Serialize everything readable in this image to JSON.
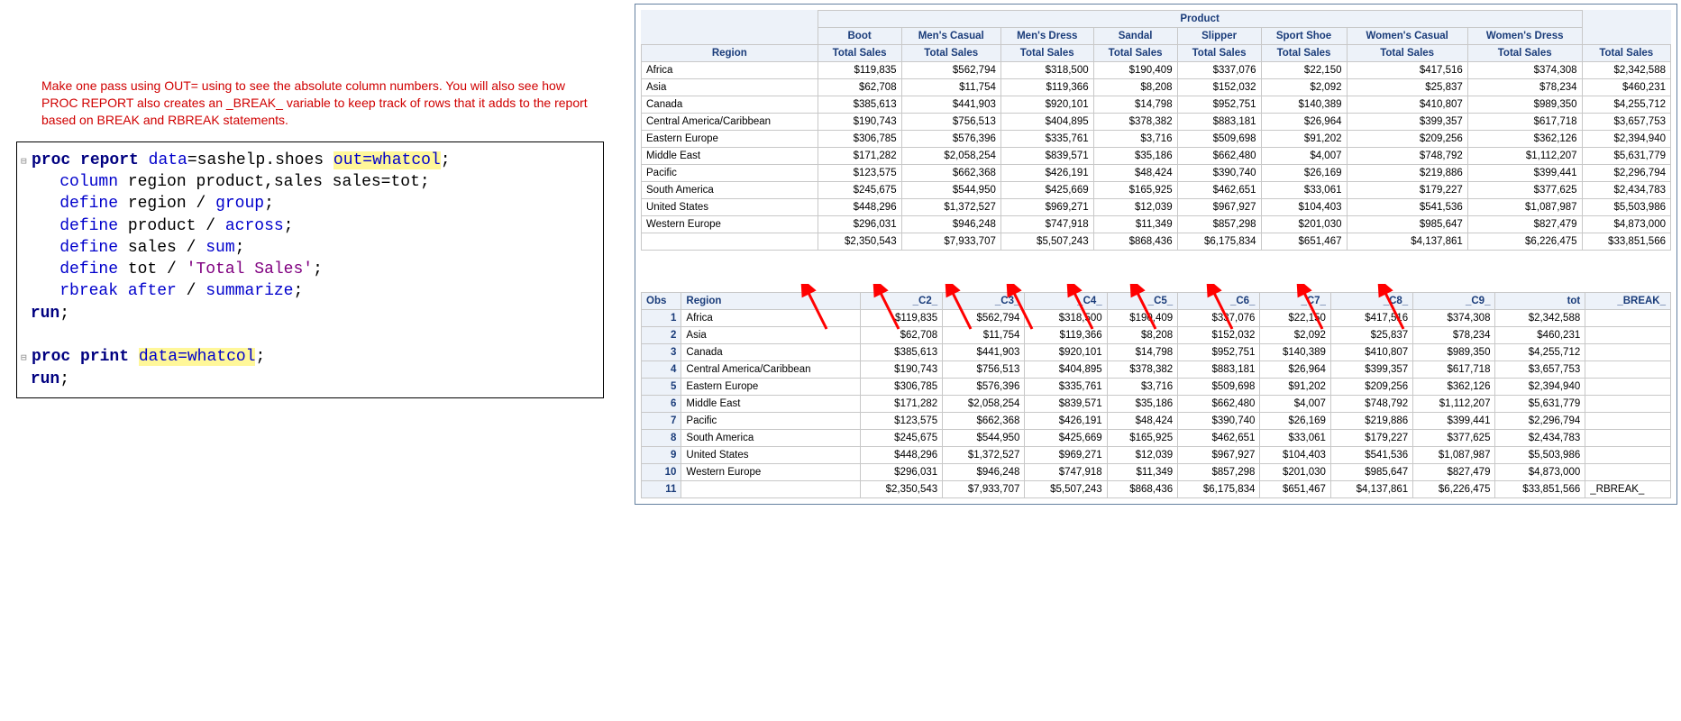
{
  "comment": "Make one pass using OUT= using to see the absolute column numbers. You will also see how PROC REPORT also creates an _BREAK_ variable to keep track of rows that it adds to the report based on BREAK and RBREAK statements.",
  "code": {
    "l1a": "proc",
    "l1b": "report",
    "l1c": "data",
    "l1d": "=sashelp.shoes ",
    "l1e": "out=whatcol",
    "l1f": ";",
    "l2a": "   column",
    "l2b": " region product,sales sales=tot;",
    "l3a": "   define",
    "l3b": " region / ",
    "l3c": "group",
    "l3d": ";",
    "l4a": "   define",
    "l4b": " product / ",
    "l4c": "across",
    "l4d": ";",
    "l5a": "   define",
    "l5b": " sales / ",
    "l5c": "sum",
    "l5d": ";",
    "l6a": "   define",
    "l6b": " tot / ",
    "l6c": "'Total Sales'",
    "l6d": ";",
    "l7a": "   rbreak",
    "l7b": "after",
    "l7c": " / ",
    "l7d": "summarize",
    "l7e": ";",
    "l8": "run",
    "l9a": "proc",
    "l9b": "print",
    "l9c": "data=whatcol",
    "l9d": ";",
    "l10": "run"
  },
  "report": {
    "spanHeader": "Product",
    "rowHeader": "Region",
    "subHeader": "Total Sales",
    "products": [
      "Boot",
      "Men's Casual",
      "Men's Dress",
      "Sandal",
      "Slipper",
      "Sport Shoe",
      "Women's Casual",
      "Women's Dress"
    ],
    "rows": [
      {
        "region": "Africa",
        "v": [
          "$119,835",
          "$562,794",
          "$318,500",
          "$190,409",
          "$337,076",
          "$22,150",
          "$417,516",
          "$374,308",
          "$2,342,588"
        ]
      },
      {
        "region": "Asia",
        "v": [
          "$62,708",
          "$11,754",
          "$119,366",
          "$8,208",
          "$152,032",
          "$2,092",
          "$25,837",
          "$78,234",
          "$460,231"
        ]
      },
      {
        "region": "Canada",
        "v": [
          "$385,613",
          "$441,903",
          "$920,101",
          "$14,798",
          "$952,751",
          "$140,389",
          "$410,807",
          "$989,350",
          "$4,255,712"
        ]
      },
      {
        "region": "Central America/Caribbean",
        "v": [
          "$190,743",
          "$756,513",
          "$404,895",
          "$378,382",
          "$883,181",
          "$26,964",
          "$399,357",
          "$617,718",
          "$3,657,753"
        ]
      },
      {
        "region": "Eastern Europe",
        "v": [
          "$306,785",
          "$576,396",
          "$335,761",
          "$3,716",
          "$509,698",
          "$91,202",
          "$209,256",
          "$362,126",
          "$2,394,940"
        ]
      },
      {
        "region": "Middle East",
        "v": [
          "$171,282",
          "$2,058,254",
          "$839,571",
          "$35,186",
          "$662,480",
          "$4,007",
          "$748,792",
          "$1,112,207",
          "$5,631,779"
        ]
      },
      {
        "region": "Pacific",
        "v": [
          "$123,575",
          "$662,368",
          "$426,191",
          "$48,424",
          "$390,740",
          "$26,169",
          "$219,886",
          "$399,441",
          "$2,296,794"
        ]
      },
      {
        "region": "South America",
        "v": [
          "$245,675",
          "$544,950",
          "$425,669",
          "$165,925",
          "$462,651",
          "$33,061",
          "$179,227",
          "$377,625",
          "$2,434,783"
        ]
      },
      {
        "region": "United States",
        "v": [
          "$448,296",
          "$1,372,527",
          "$969,271",
          "$12,039",
          "$967,927",
          "$104,403",
          "$541,536",
          "$1,087,987",
          "$5,503,986"
        ]
      },
      {
        "region": "Western Europe",
        "v": [
          "$296,031",
          "$946,248",
          "$747,918",
          "$11,349",
          "$857,298",
          "$201,030",
          "$985,647",
          "$827,479",
          "$4,873,000"
        ]
      }
    ],
    "summary": [
      "$2,350,543",
      "$7,933,707",
      "$5,507,243",
      "$868,436",
      "$6,175,834",
      "$651,467",
      "$4,137,861",
      "$6,226,475",
      "$33,851,566"
    ]
  },
  "print": {
    "headers": [
      "Obs",
      "Region",
      "_C2_",
      "_C3_",
      "_C4_",
      "_C5_",
      "_C6_",
      "_C7_",
      "_C8_",
      "_C9_",
      "tot",
      "_BREAK_"
    ],
    "rows": [
      {
        "obs": "1",
        "region": "Africa",
        "v": [
          "$119,835",
          "$562,794",
          "$318,500",
          "$190,409",
          "$337,076",
          "$22,150",
          "$417,516",
          "$374,308",
          "$2,342,588",
          ""
        ]
      },
      {
        "obs": "2",
        "region": "Asia",
        "v": [
          "$62,708",
          "$11,754",
          "$119,366",
          "$8,208",
          "$152,032",
          "$2,092",
          "$25,837",
          "$78,234",
          "$460,231",
          ""
        ]
      },
      {
        "obs": "3",
        "region": "Canada",
        "v": [
          "$385,613",
          "$441,903",
          "$920,101",
          "$14,798",
          "$952,751",
          "$140,389",
          "$410,807",
          "$989,350",
          "$4,255,712",
          ""
        ]
      },
      {
        "obs": "4",
        "region": "Central America/Caribbean",
        "v": [
          "$190,743",
          "$756,513",
          "$404,895",
          "$378,382",
          "$883,181",
          "$26,964",
          "$399,357",
          "$617,718",
          "$3,657,753",
          ""
        ]
      },
      {
        "obs": "5",
        "region": "Eastern Europe",
        "v": [
          "$306,785",
          "$576,396",
          "$335,761",
          "$3,716",
          "$509,698",
          "$91,202",
          "$209,256",
          "$362,126",
          "$2,394,940",
          ""
        ]
      },
      {
        "obs": "6",
        "region": "Middle East",
        "v": [
          "$171,282",
          "$2,058,254",
          "$839,571",
          "$35,186",
          "$662,480",
          "$4,007",
          "$748,792",
          "$1,112,207",
          "$5,631,779",
          ""
        ]
      },
      {
        "obs": "7",
        "region": "Pacific",
        "v": [
          "$123,575",
          "$662,368",
          "$426,191",
          "$48,424",
          "$390,740",
          "$26,169",
          "$219,886",
          "$399,441",
          "$2,296,794",
          ""
        ]
      },
      {
        "obs": "8",
        "region": "South America",
        "v": [
          "$245,675",
          "$544,950",
          "$425,669",
          "$165,925",
          "$462,651",
          "$33,061",
          "$179,227",
          "$377,625",
          "$2,434,783",
          ""
        ]
      },
      {
        "obs": "9",
        "region": "United States",
        "v": [
          "$448,296",
          "$1,372,527",
          "$969,271",
          "$12,039",
          "$967,927",
          "$104,403",
          "$541,536",
          "$1,087,987",
          "$5,503,986",
          ""
        ]
      },
      {
        "obs": "10",
        "region": "Western Europe",
        "v": [
          "$296,031",
          "$946,248",
          "$747,918",
          "$11,349",
          "$857,298",
          "$201,030",
          "$985,647",
          "$827,479",
          "$4,873,000",
          ""
        ]
      },
      {
        "obs": "11",
        "region": "",
        "v": [
          "$2,350,543",
          "$7,933,707",
          "$5,507,243",
          "$868,436",
          "$6,175,834",
          "$651,467",
          "$4,137,861",
          "$6,226,475",
          "$33,851,566",
          "_RBREAK_"
        ]
      }
    ]
  }
}
